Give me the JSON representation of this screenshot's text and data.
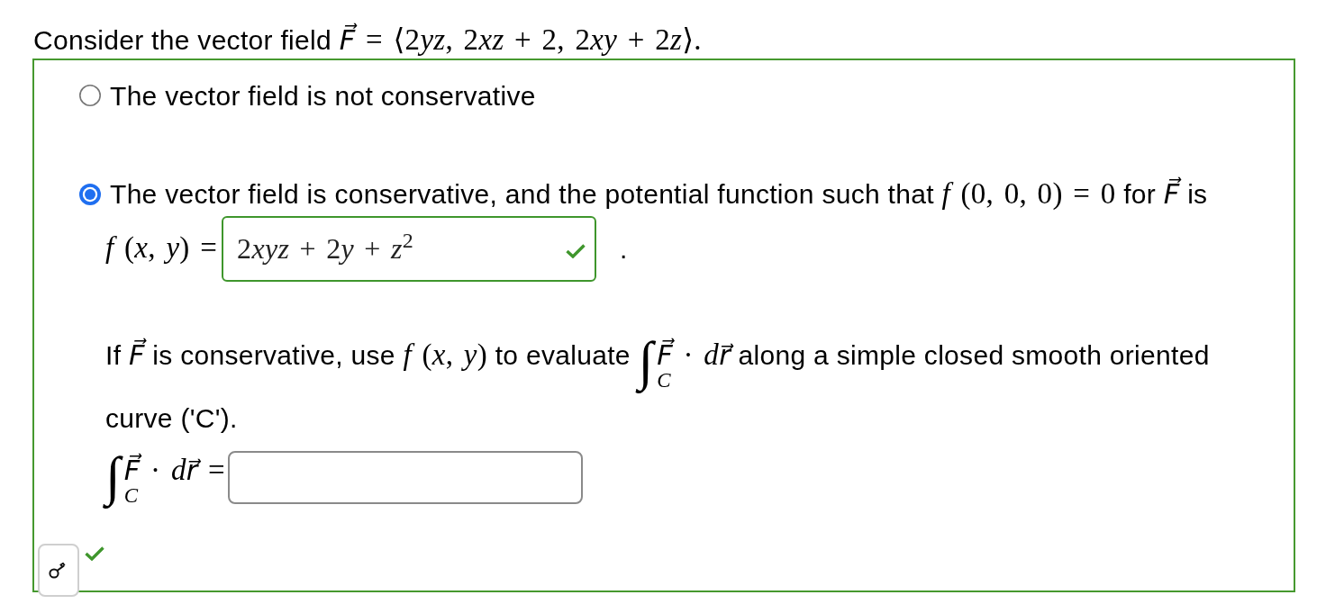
{
  "question": {
    "segments": [
      {
        "kind": "text",
        "text": "Consider the vector field"
      },
      {
        "kind": "math",
        "text": "F⃗ = ⟨2yz, 2xz + 2, 2xy + 2z⟩."
      }
    ]
  },
  "options": [
    {
      "kind": "plain",
      "selected": false,
      "segments": [
        {
          "kind": "text",
          "text": "The vector field is not conservative"
        }
      ]
    },
    {
      "kind": "with_answer",
      "selected": true,
      "segments": [
        {
          "kind": "text",
          "text": "The vector field is conservative, and the potential function such that"
        },
        {
          "kind": "math",
          "text": "f (0, 0, 0) = 0"
        },
        {
          "kind": "text",
          "text": "for"
        },
        {
          "kind": "math",
          "text": "F⃗"
        },
        {
          "kind": "text",
          "text": "is"
        }
      ],
      "answer": {
        "lead": "f (x, y) =",
        "value": "2xyz + 2y + z$^{2}$",
        "correct": true,
        "trailing": "."
      },
      "followup": {
        "segments": [
          {
            "kind": "text",
            "text": "If"
          },
          {
            "kind": "math",
            "text": "F⃗"
          },
          {
            "kind": "text",
            "text": "is conservative, use"
          },
          {
            "kind": "math",
            "text": "f (x, y)"
          },
          {
            "kind": "text",
            "text": "to evaluate"
          },
          {
            "kind": "integral",
            "symbol": "∫",
            "lower": "C",
            "integrand": "F⃗ · dr⃗"
          },
          {
            "kind": "text",
            "text": "along a simple closed smooth oriented curve ('C')."
          }
        ]
      },
      "integral_answer": {
        "symbol": "∫",
        "lower": "C",
        "integrand": "F⃗ · dr⃗ =",
        "correct": false
      }
    }
  ],
  "result": {
    "correct": true
  }
}
